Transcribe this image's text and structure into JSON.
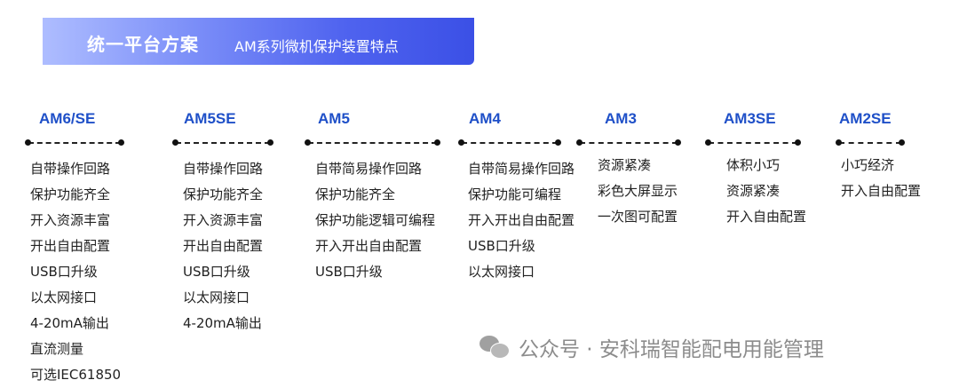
{
  "banner": {
    "title": "统一平台方案",
    "subtitle": "AM系列微机保护装置特点"
  },
  "columns": [
    {
      "name": "AM6/SE",
      "features": [
        "自带操作回路",
        "保护功能齐全",
        "开入资源丰富",
        "开出自由配置",
        "USB口升级",
        "以太网接口",
        "4-20mA输出",
        "直流测量",
        "可选IEC61850"
      ]
    },
    {
      "name": "AM5SE",
      "features": [
        "自带操作回路",
        "保护功能齐全",
        "开入资源丰富",
        "开出自由配置",
        "USB口升级",
        "以太网接口",
        "4-20mA输出"
      ]
    },
    {
      "name": "AM5",
      "features": [
        "自带简易操作回路",
        "保护功能齐全",
        "保护功能逻辑可编程",
        "开入开出自由配置",
        "USB口升级"
      ]
    },
    {
      "name": "AM4",
      "features": [
        "自带简易操作回路",
        "保护功能可编程",
        "开入开出自由配置",
        "USB口升级",
        "以太网接口"
      ]
    },
    {
      "name": "AM3",
      "features": [
        "资源紧凑",
        "彩色大屏显示",
        "一次图可配置"
      ]
    },
    {
      "name": "AM3SE",
      "features": [
        "体积小巧",
        "资源紧凑",
        "开入自由配置"
      ]
    },
    {
      "name": "AM2SE",
      "features": [
        "小巧经济",
        "开入自由配置"
      ]
    }
  ],
  "watermark": {
    "text": "公众号 · 安科瑞智能配电用能管理",
    "icon": "wechat-icon"
  }
}
